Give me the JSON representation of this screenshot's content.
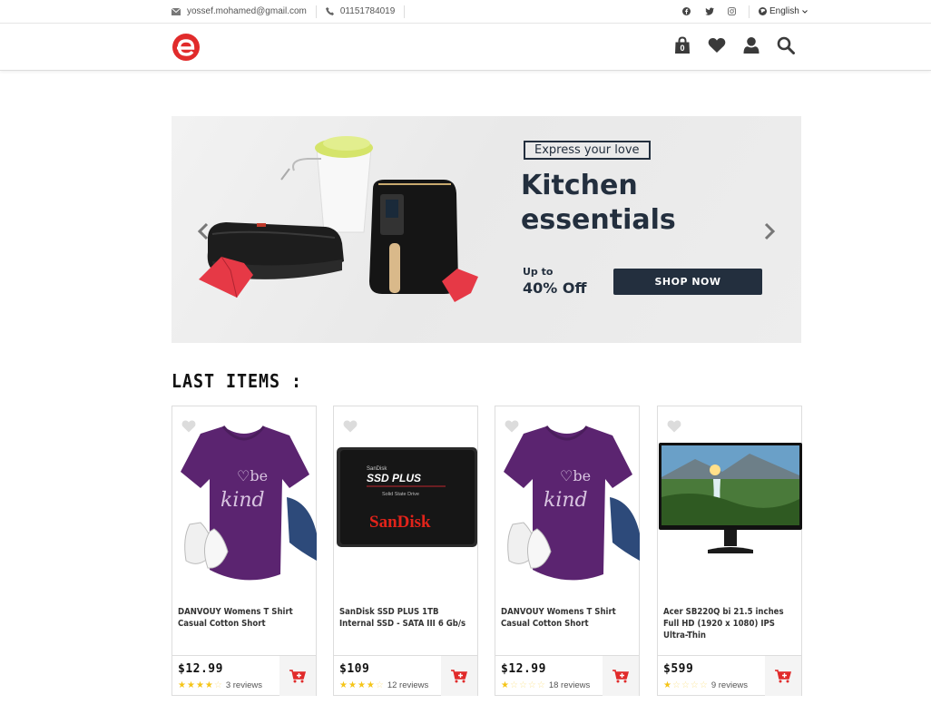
{
  "topbar": {
    "email": "yossef.mohamed@gmail.com",
    "phone": "01151784019",
    "social": [
      "facebook-icon",
      "twitter-icon",
      "instagram-icon"
    ],
    "language": "English"
  },
  "header": {
    "cart_count": "0",
    "icons": [
      "shopping-bag-icon",
      "heart-icon",
      "user-icon",
      "search-icon"
    ],
    "brand_color": "#e12b2b"
  },
  "banner": {
    "tagline": "Express your love",
    "headline_line1": "Kitchen",
    "headline_line2": "essentials",
    "upto": "Up to",
    "discount": "40% Off",
    "cta": "SHOP NOW",
    "dark_color": "#232f3e"
  },
  "section": {
    "title": "LAST ITEMS :"
  },
  "products": [
    {
      "name": "DANVOUY Womens T Shirt Casual Cotton Short",
      "price": "$12.99",
      "rating": 4,
      "reviews": "3 reviews",
      "image": "tshirt"
    },
    {
      "name": "SanDisk SSD PLUS 1TB Internal SSD - SATA III 6 Gb/s",
      "price": "$109",
      "rating": 4,
      "reviews": "12 reviews",
      "image": "ssd"
    },
    {
      "name": "DANVOUY Womens T Shirt Casual Cotton Short",
      "price": "$12.99",
      "rating": 1,
      "reviews": "18 reviews",
      "image": "tshirt"
    },
    {
      "name": "Acer SB220Q bi 21.5 inches Full HD (1920 x 1080) IPS Ultra-Thin",
      "price": "$599",
      "rating": 1,
      "reviews": "9 reviews",
      "image": "monitor"
    }
  ],
  "ssd_art": {
    "brand_small": "SanDisk",
    "model": "SSD PLUS",
    "sub": "Solid State Drive",
    "logo": "SanDisk"
  },
  "tshirt_art": {
    "text1": "♡be",
    "text2": "kind"
  }
}
